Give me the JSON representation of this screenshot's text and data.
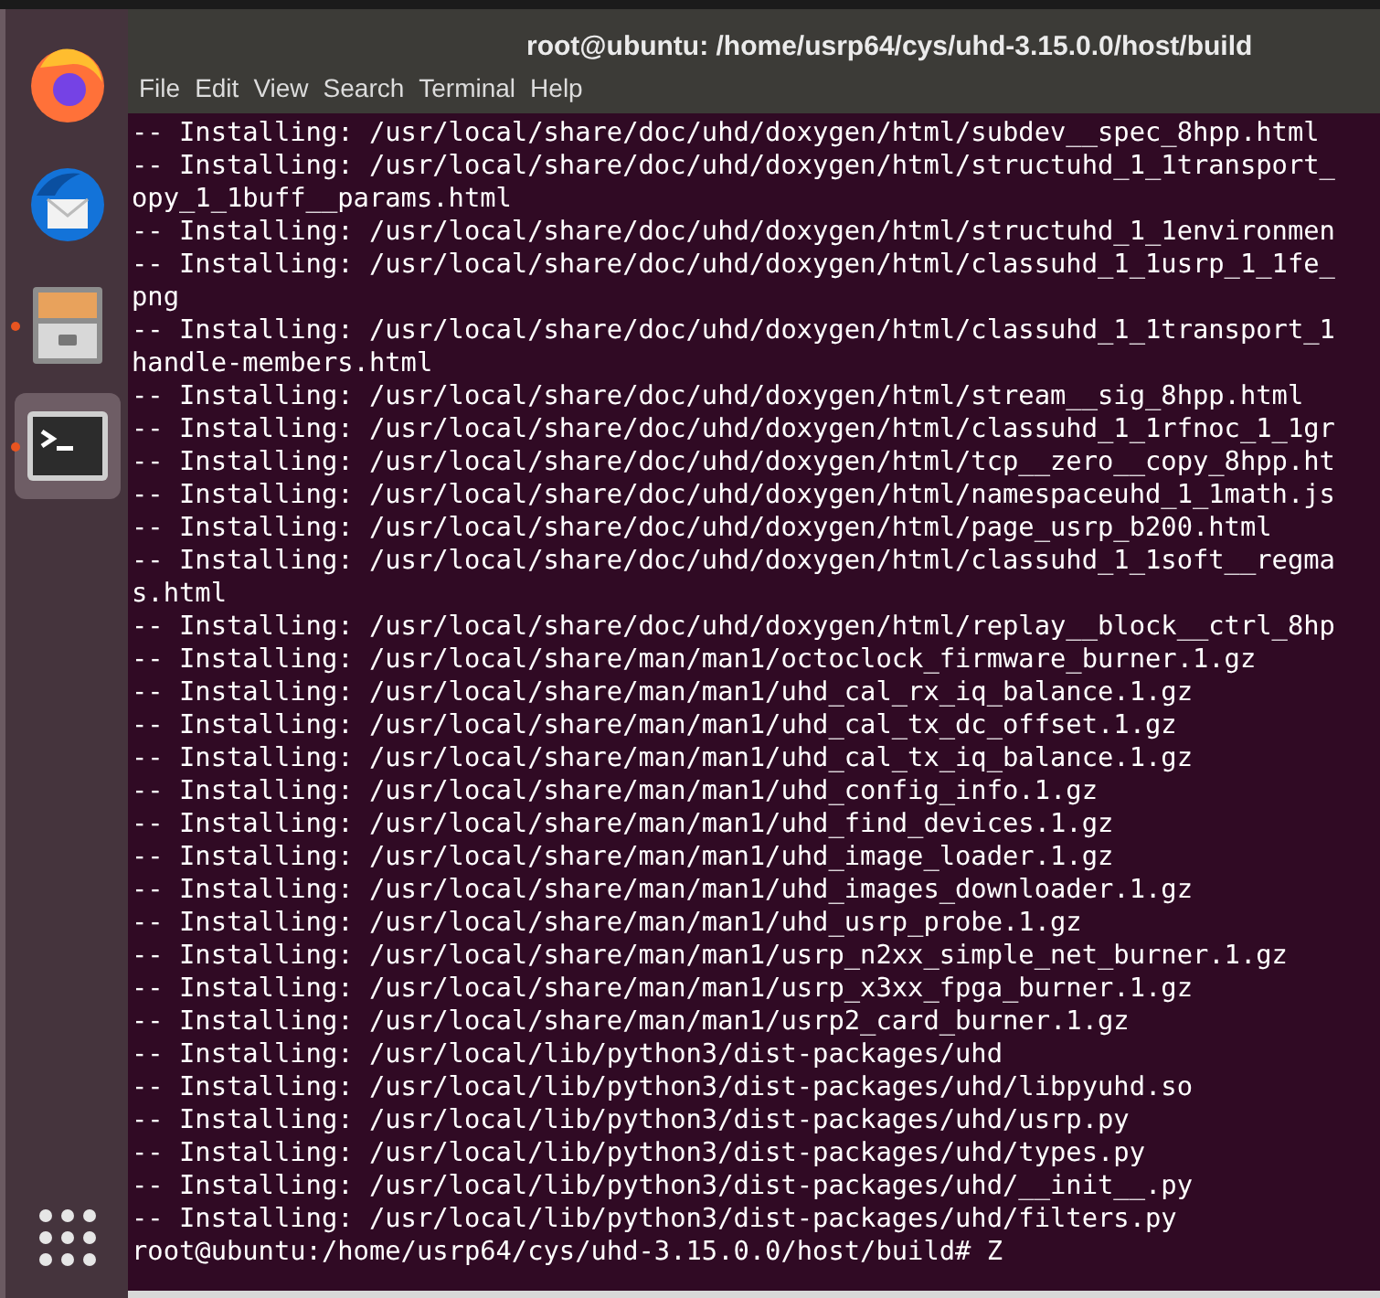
{
  "dock": {
    "items": [
      {
        "kind": "browser",
        "running": false,
        "selected": false
      },
      {
        "kind": "mail",
        "running": false,
        "selected": false
      },
      {
        "kind": "files",
        "running": true,
        "selected": false
      },
      {
        "kind": "terminal",
        "running": true,
        "selected": true
      }
    ]
  },
  "window": {
    "title": "root@ubuntu: /home/usrp64/cys/uhd-3.15.0.0/host/build"
  },
  "menu": [
    "File",
    "Edit",
    "View",
    "Search",
    "Terminal",
    "Help"
  ],
  "terminal": {
    "lines": [
      "-- Installing: /usr/local/share/doc/uhd/doxygen/html/subdev__spec_8hpp.html",
      "-- Installing: /usr/local/share/doc/uhd/doxygen/html/structuhd_1_1transport_",
      "opy_1_1buff__params.html",
      "-- Installing: /usr/local/share/doc/uhd/doxygen/html/structuhd_1_1environmen",
      "-- Installing: /usr/local/share/doc/uhd/doxygen/html/classuhd_1_1usrp_1_1fe_",
      "png",
      "-- Installing: /usr/local/share/doc/uhd/doxygen/html/classuhd_1_1transport_1",
      "handle-members.html",
      "-- Installing: /usr/local/share/doc/uhd/doxygen/html/stream__sig_8hpp.html",
      "-- Installing: /usr/local/share/doc/uhd/doxygen/html/classuhd_1_1rfnoc_1_1gr",
      "-- Installing: /usr/local/share/doc/uhd/doxygen/html/tcp__zero__copy_8hpp.ht",
      "-- Installing: /usr/local/share/doc/uhd/doxygen/html/namespaceuhd_1_1math.js",
      "-- Installing: /usr/local/share/doc/uhd/doxygen/html/page_usrp_b200.html",
      "-- Installing: /usr/local/share/doc/uhd/doxygen/html/classuhd_1_1soft__regma",
      "s.html",
      "-- Installing: /usr/local/share/doc/uhd/doxygen/html/replay__block__ctrl_8hp",
      "-- Installing: /usr/local/share/man/man1/octoclock_firmware_burner.1.gz",
      "-- Installing: /usr/local/share/man/man1/uhd_cal_rx_iq_balance.1.gz",
      "-- Installing: /usr/local/share/man/man1/uhd_cal_tx_dc_offset.1.gz",
      "-- Installing: /usr/local/share/man/man1/uhd_cal_tx_iq_balance.1.gz",
      "-- Installing: /usr/local/share/man/man1/uhd_config_info.1.gz",
      "-- Installing: /usr/local/share/man/man1/uhd_find_devices.1.gz",
      "-- Installing: /usr/local/share/man/man1/uhd_image_loader.1.gz",
      "-- Installing: /usr/local/share/man/man1/uhd_images_downloader.1.gz",
      "-- Installing: /usr/local/share/man/man1/uhd_usrp_probe.1.gz",
      "-- Installing: /usr/local/share/man/man1/usrp_n2xx_simple_net_burner.1.gz",
      "-- Installing: /usr/local/share/man/man1/usrp_x3xx_fpga_burner.1.gz",
      "-- Installing: /usr/local/share/man/man1/usrp2_card_burner.1.gz",
      "-- Installing: /usr/local/lib/python3/dist-packages/uhd",
      "-- Installing: /usr/local/lib/python3/dist-packages/uhd/libpyuhd.so",
      "-- Installing: /usr/local/lib/python3/dist-packages/uhd/usrp.py",
      "-- Installing: /usr/local/lib/python3/dist-packages/uhd/types.py",
      "-- Installing: /usr/local/lib/python3/dist-packages/uhd/__init__.py",
      "-- Installing: /usr/local/lib/python3/dist-packages/uhd/filters.py"
    ],
    "prompt": "root@ubuntu:/home/usrp64/cys/uhd-3.15.0.0/host/build# Z"
  }
}
